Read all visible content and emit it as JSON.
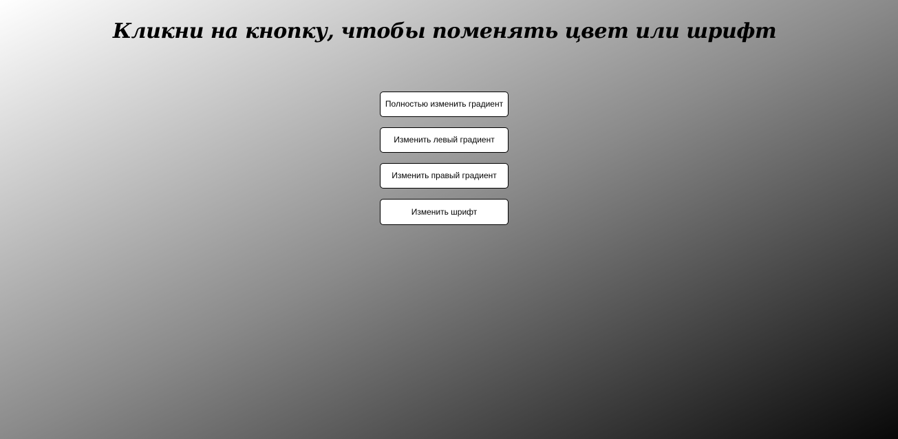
{
  "page": {
    "title": "Кликни на кнопку, чтобы поменять цвет или шрифт"
  },
  "buttons": {
    "full_gradient": "Полностью изменить градиент",
    "left_gradient": "Изменить левый градиент",
    "right_gradient": "Изменить правый градиент",
    "font": "Изменить шрифт"
  },
  "colors": {
    "gradient_start": "#ffffff",
    "gradient_end": "#080808",
    "button_background": "#ffffff",
    "text": "#000000"
  }
}
